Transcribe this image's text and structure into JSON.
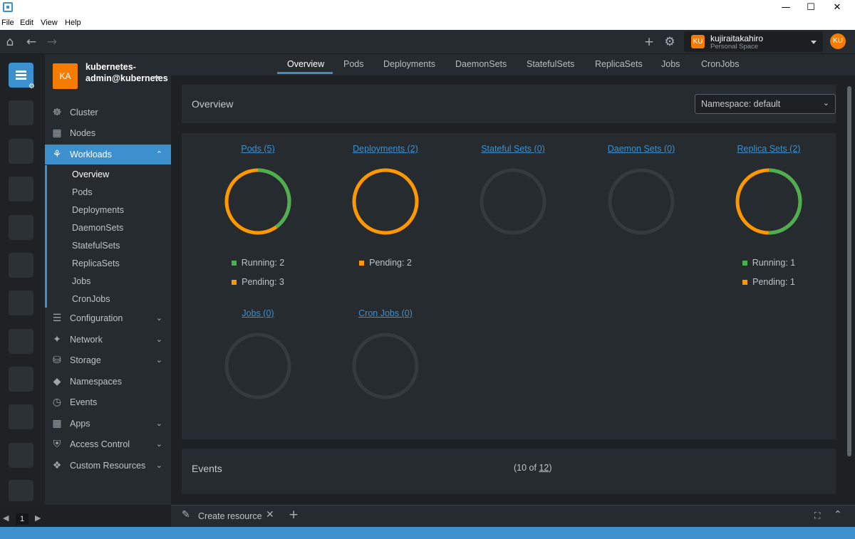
{
  "menu": [
    "File",
    "Edit",
    "View",
    "Help"
  ],
  "user": {
    "initials": "KU",
    "name": "kujiraitakahiro",
    "space": "Personal Space"
  },
  "hotbar": {
    "page": "1"
  },
  "cluster": {
    "initials": "KA",
    "name": "kubernetes-admin@kubernetes"
  },
  "sidebar": {
    "items": [
      {
        "label": "Cluster",
        "icon": "helm-icon"
      },
      {
        "label": "Nodes",
        "icon": "nodes-icon"
      },
      {
        "label": "Workloads",
        "icon": "workloads-icon",
        "expanded": true
      },
      {
        "label": "Configuration",
        "icon": "list-icon"
      },
      {
        "label": "Network",
        "icon": "network-icon"
      },
      {
        "label": "Storage",
        "icon": "storage-icon"
      },
      {
        "label": "Namespaces",
        "icon": "layers-icon"
      },
      {
        "label": "Events",
        "icon": "clock-icon"
      },
      {
        "label": "Apps",
        "icon": "grid-icon"
      },
      {
        "label": "Access Control",
        "icon": "shield-icon"
      },
      {
        "label": "Custom Resources",
        "icon": "puzzle-icon"
      }
    ],
    "subitems": [
      "Overview",
      "Pods",
      "Deployments",
      "DaemonSets",
      "StatefulSets",
      "ReplicaSets",
      "Jobs",
      "CronJobs"
    ]
  },
  "tabs": [
    "Overview",
    "Pods",
    "Deployments",
    "DaemonSets",
    "StatefulSets",
    "ReplicaSets",
    "Jobs",
    "CronJobs"
  ],
  "overview": {
    "title": "Overview",
    "namespace": "Namespace: default"
  },
  "colors": {
    "running": "#4caf50",
    "pending": "#ff9800",
    "empty": "#343a3f",
    "accent": "#3d90ce"
  },
  "charts": [
    {
      "title": "Pods (5)",
      "running": 2,
      "pending": 3,
      "legend": [
        "Running: 2",
        "Pending: 3"
      ]
    },
    {
      "title": "Deployments (2)",
      "running": 0,
      "pending": 2,
      "legend": [
        "Pending: 2"
      ]
    },
    {
      "title": "Stateful Sets (0)",
      "running": 0,
      "pending": 0,
      "legend": []
    },
    {
      "title": "Daemon Sets (0)",
      "running": 0,
      "pending": 0,
      "legend": []
    },
    {
      "title": "Replica Sets (2)",
      "running": 1,
      "pending": 1,
      "legend": [
        "Running: 1",
        "Pending: 1"
      ]
    },
    {
      "title": "Jobs (0)",
      "running": 0,
      "pending": 0,
      "legend": []
    },
    {
      "title": "Cron Jobs (0)",
      "running": 0,
      "pending": 0,
      "legend": []
    }
  ],
  "events": {
    "title": "Events",
    "count_prefix": "(10 of ",
    "count_link": "12",
    "count_suffix": ")"
  },
  "dock": {
    "tab_label": "Create resource"
  }
}
